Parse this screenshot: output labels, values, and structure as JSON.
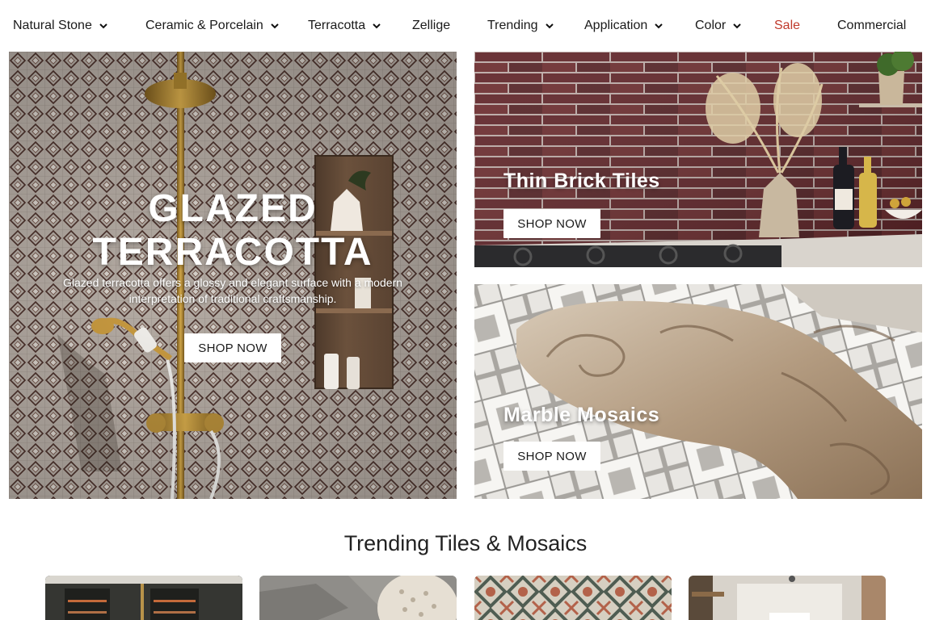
{
  "nav": {
    "items": [
      {
        "label": "Natural Stone",
        "has_dropdown": true
      },
      {
        "label": "Ceramic & Porcelain",
        "has_dropdown": true
      },
      {
        "label": "Terracotta",
        "has_dropdown": true
      },
      {
        "label": "Zellige",
        "has_dropdown": false
      },
      {
        "label": "Trending",
        "has_dropdown": true
      },
      {
        "label": "Application",
        "has_dropdown": true
      },
      {
        "label": "Color",
        "has_dropdown": true
      },
      {
        "label": "Sale",
        "has_dropdown": false,
        "color": "#c0392b"
      },
      {
        "label": "Commercial",
        "has_dropdown": false
      }
    ]
  },
  "hero": {
    "left": {
      "headline_line1": "GLAZED",
      "headline_line2": "TERRACOTTA",
      "subtext_line1": "Glazed terracotta offers a glossy and elegant surface with a modern",
      "subtext_line2": "interpretation of traditional craftsmanship.",
      "button": "SHOP NOW"
    },
    "top_right": {
      "title": "Thin Brick Tiles",
      "button": "SHOP NOW"
    },
    "bottom_right": {
      "title": "Marble Mosaics",
      "button": "SHOP NOW"
    }
  },
  "trending": {
    "heading": "Trending Tiles & Mosaics",
    "cards": [
      {
        "image": "dark-kitchen-shelving"
      },
      {
        "image": "gray-stone-tile"
      },
      {
        "image": "patterned-cement-tile"
      },
      {
        "image": "kitchen-room"
      }
    ]
  },
  "colors": {
    "sale": "#c0392b",
    "brick": "#5a2326",
    "terracotta_bg": "#a39a92"
  }
}
